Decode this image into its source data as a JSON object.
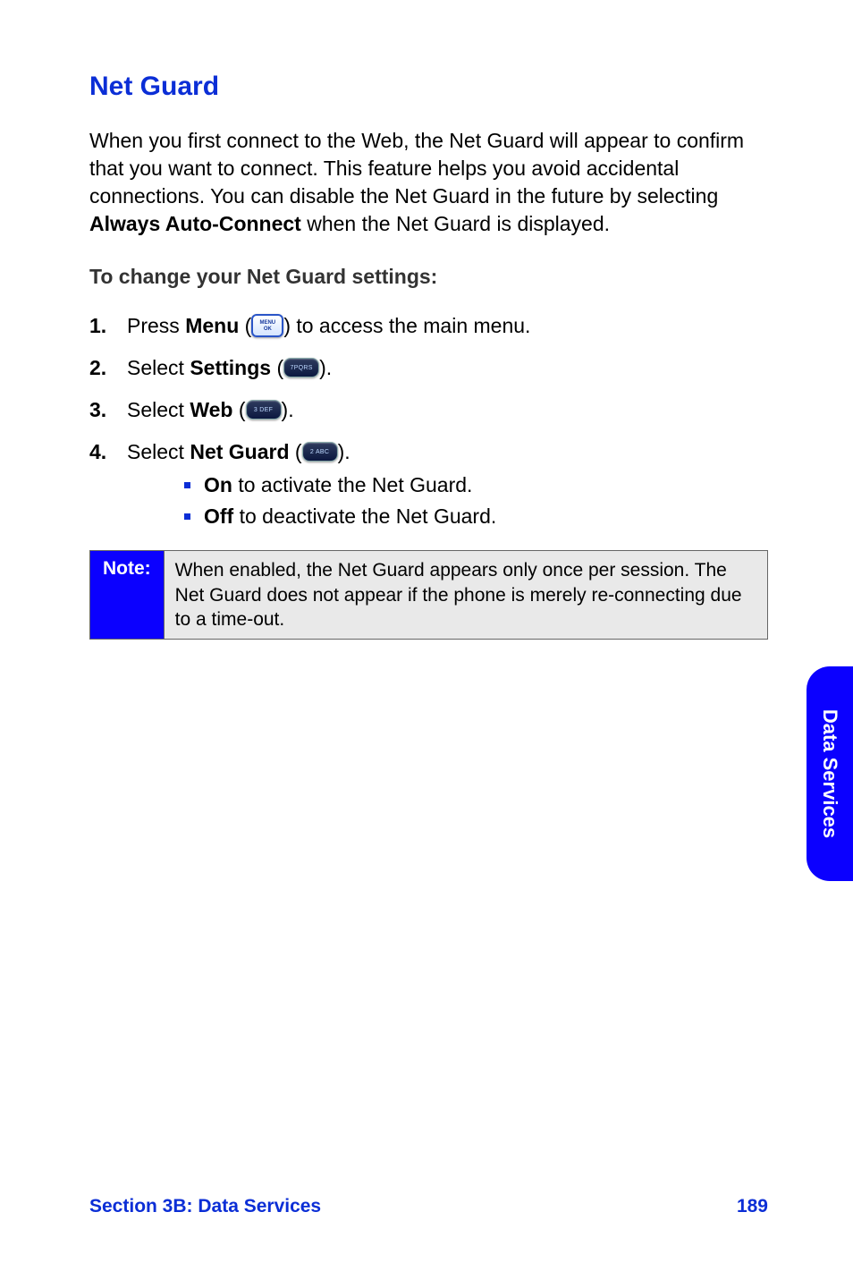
{
  "title": "Net Guard",
  "intro": {
    "part1": "When you first connect to the Web, the Net Guard will appear to confirm that you want to connect. This feature helps you avoid accidental connections. You can disable the Net Guard in the future by selecting ",
    "bold": "Always Auto-Connect",
    "part2": " when the Net Guard is displayed."
  },
  "subheading": "To change your Net Guard settings:",
  "steps": [
    {
      "num": "1.",
      "pre": "Press ",
      "bold": "Menu",
      "post_open": " (",
      "key_label": "MENU OK",
      "post_close": ") to access the main menu."
    },
    {
      "num": "2.",
      "pre": "Select ",
      "bold": "Settings",
      "post_open": " (",
      "key_label": "7PQRS",
      "post_close": ")."
    },
    {
      "num": "3.",
      "pre": "Select ",
      "bold": "Web",
      "post_open": " (",
      "key_label": "3 DEF",
      "post_close": ")."
    },
    {
      "num": "4.",
      "pre": "Select ",
      "bold": "Net Guard",
      "post_open": " (",
      "key_label": "2 ABC",
      "post_close": ")."
    }
  ],
  "subitems": [
    {
      "bold": "On",
      "rest": " to activate the Net Guard."
    },
    {
      "bold": "Off",
      "rest": " to deactivate the Net Guard."
    }
  ],
  "note": {
    "label": "Note:",
    "body": "When enabled, the Net Guard appears only once per session. The Net Guard does not appear if the phone is merely re-connecting due to a time-out."
  },
  "side_tab": "Data Services",
  "footer": {
    "section": "Section 3B: Data Services",
    "page": "189"
  }
}
